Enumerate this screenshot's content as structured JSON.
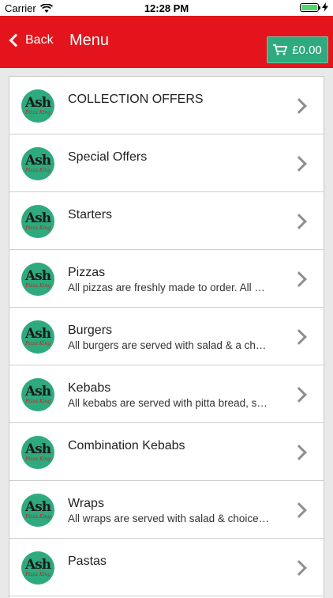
{
  "status_bar": {
    "carrier": "Carrier",
    "time": "12:28 PM",
    "icons": [
      "wifi-icon",
      "battery-icon",
      "charging-icon"
    ]
  },
  "nav": {
    "back_label": "Back",
    "title": "Menu",
    "cart_total": "£0.00",
    "colors": {
      "bar": "#e3141b",
      "cart": "#2eaa7e"
    }
  },
  "menu": {
    "logo_text": "Ash",
    "logo_subtext": "Pizza King",
    "items": [
      {
        "title": "COLLECTION OFFERS",
        "description": ""
      },
      {
        "title": "Special Offers",
        "description": ""
      },
      {
        "title": "Starters",
        "description": ""
      },
      {
        "title": "Pizzas",
        "description": "All pizzas are freshly made to order. All …"
      },
      {
        "title": "Burgers",
        "description": "All burgers are served with salad & a ch…"
      },
      {
        "title": "Kebabs",
        "description": "All kebabs are served with pitta bread, s…"
      },
      {
        "title": "Combination Kebabs",
        "description": ""
      },
      {
        "title": "Wraps",
        "description": "All wraps are served with salad & choice…"
      },
      {
        "title": "Pastas",
        "description": ""
      }
    ]
  }
}
